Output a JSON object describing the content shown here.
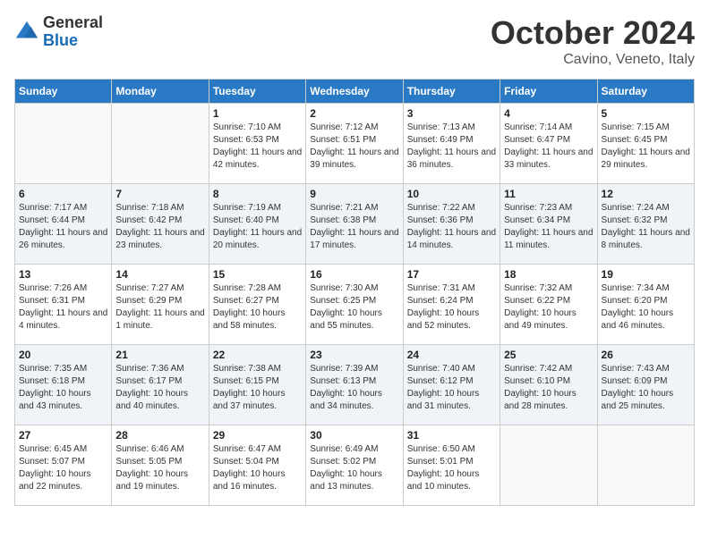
{
  "header": {
    "logo_general": "General",
    "logo_blue": "Blue",
    "month_title": "October 2024",
    "location": "Cavino, Veneto, Italy"
  },
  "weekdays": [
    "Sunday",
    "Monday",
    "Tuesday",
    "Wednesday",
    "Thursday",
    "Friday",
    "Saturday"
  ],
  "weeks": [
    [
      {
        "day": "",
        "info": ""
      },
      {
        "day": "",
        "info": ""
      },
      {
        "day": "1",
        "info": "Sunrise: 7:10 AM\nSunset: 6:53 PM\nDaylight: 11 hours and 42 minutes."
      },
      {
        "day": "2",
        "info": "Sunrise: 7:12 AM\nSunset: 6:51 PM\nDaylight: 11 hours and 39 minutes."
      },
      {
        "day": "3",
        "info": "Sunrise: 7:13 AM\nSunset: 6:49 PM\nDaylight: 11 hours and 36 minutes."
      },
      {
        "day": "4",
        "info": "Sunrise: 7:14 AM\nSunset: 6:47 PM\nDaylight: 11 hours and 33 minutes."
      },
      {
        "day": "5",
        "info": "Sunrise: 7:15 AM\nSunset: 6:45 PM\nDaylight: 11 hours and 29 minutes."
      }
    ],
    [
      {
        "day": "6",
        "info": "Sunrise: 7:17 AM\nSunset: 6:44 PM\nDaylight: 11 hours and 26 minutes."
      },
      {
        "day": "7",
        "info": "Sunrise: 7:18 AM\nSunset: 6:42 PM\nDaylight: 11 hours and 23 minutes."
      },
      {
        "day": "8",
        "info": "Sunrise: 7:19 AM\nSunset: 6:40 PM\nDaylight: 11 hours and 20 minutes."
      },
      {
        "day": "9",
        "info": "Sunrise: 7:21 AM\nSunset: 6:38 PM\nDaylight: 11 hours and 17 minutes."
      },
      {
        "day": "10",
        "info": "Sunrise: 7:22 AM\nSunset: 6:36 PM\nDaylight: 11 hours and 14 minutes."
      },
      {
        "day": "11",
        "info": "Sunrise: 7:23 AM\nSunset: 6:34 PM\nDaylight: 11 hours and 11 minutes."
      },
      {
        "day": "12",
        "info": "Sunrise: 7:24 AM\nSunset: 6:32 PM\nDaylight: 11 hours and 8 minutes."
      }
    ],
    [
      {
        "day": "13",
        "info": "Sunrise: 7:26 AM\nSunset: 6:31 PM\nDaylight: 11 hours and 4 minutes."
      },
      {
        "day": "14",
        "info": "Sunrise: 7:27 AM\nSunset: 6:29 PM\nDaylight: 11 hours and 1 minute."
      },
      {
        "day": "15",
        "info": "Sunrise: 7:28 AM\nSunset: 6:27 PM\nDaylight: 10 hours and 58 minutes."
      },
      {
        "day": "16",
        "info": "Sunrise: 7:30 AM\nSunset: 6:25 PM\nDaylight: 10 hours and 55 minutes."
      },
      {
        "day": "17",
        "info": "Sunrise: 7:31 AM\nSunset: 6:24 PM\nDaylight: 10 hours and 52 minutes."
      },
      {
        "day": "18",
        "info": "Sunrise: 7:32 AM\nSunset: 6:22 PM\nDaylight: 10 hours and 49 minutes."
      },
      {
        "day": "19",
        "info": "Sunrise: 7:34 AM\nSunset: 6:20 PM\nDaylight: 10 hours and 46 minutes."
      }
    ],
    [
      {
        "day": "20",
        "info": "Sunrise: 7:35 AM\nSunset: 6:18 PM\nDaylight: 10 hours and 43 minutes."
      },
      {
        "day": "21",
        "info": "Sunrise: 7:36 AM\nSunset: 6:17 PM\nDaylight: 10 hours and 40 minutes."
      },
      {
        "day": "22",
        "info": "Sunrise: 7:38 AM\nSunset: 6:15 PM\nDaylight: 10 hours and 37 minutes."
      },
      {
        "day": "23",
        "info": "Sunrise: 7:39 AM\nSunset: 6:13 PM\nDaylight: 10 hours and 34 minutes."
      },
      {
        "day": "24",
        "info": "Sunrise: 7:40 AM\nSunset: 6:12 PM\nDaylight: 10 hours and 31 minutes."
      },
      {
        "day": "25",
        "info": "Sunrise: 7:42 AM\nSunset: 6:10 PM\nDaylight: 10 hours and 28 minutes."
      },
      {
        "day": "26",
        "info": "Sunrise: 7:43 AM\nSunset: 6:09 PM\nDaylight: 10 hours and 25 minutes."
      }
    ],
    [
      {
        "day": "27",
        "info": "Sunrise: 6:45 AM\nSunset: 5:07 PM\nDaylight: 10 hours and 22 minutes."
      },
      {
        "day": "28",
        "info": "Sunrise: 6:46 AM\nSunset: 5:05 PM\nDaylight: 10 hours and 19 minutes."
      },
      {
        "day": "29",
        "info": "Sunrise: 6:47 AM\nSunset: 5:04 PM\nDaylight: 10 hours and 16 minutes."
      },
      {
        "day": "30",
        "info": "Sunrise: 6:49 AM\nSunset: 5:02 PM\nDaylight: 10 hours and 13 minutes."
      },
      {
        "day": "31",
        "info": "Sunrise: 6:50 AM\nSunset: 5:01 PM\nDaylight: 10 hours and 10 minutes."
      },
      {
        "day": "",
        "info": ""
      },
      {
        "day": "",
        "info": ""
      }
    ]
  ]
}
